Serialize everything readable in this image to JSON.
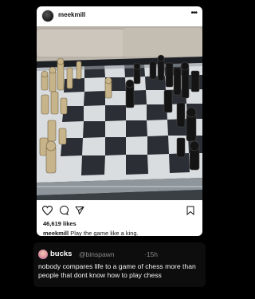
{
  "post": {
    "username": "meekmill",
    "more_icon": "more-horizontal-icon",
    "likes": "46,619 likes",
    "caption_user": "meekmill",
    "caption_text": "Play the game like a king.",
    "actions": [
      "heart-icon",
      "comment-icon",
      "share-icon",
      "bookmark-icon"
    ]
  },
  "tweet": {
    "name": "bucks",
    "handle": "@binspawn",
    "time": "·15h",
    "text": "nobody compares life to a game of chess more than people that dont know how to play chess"
  }
}
